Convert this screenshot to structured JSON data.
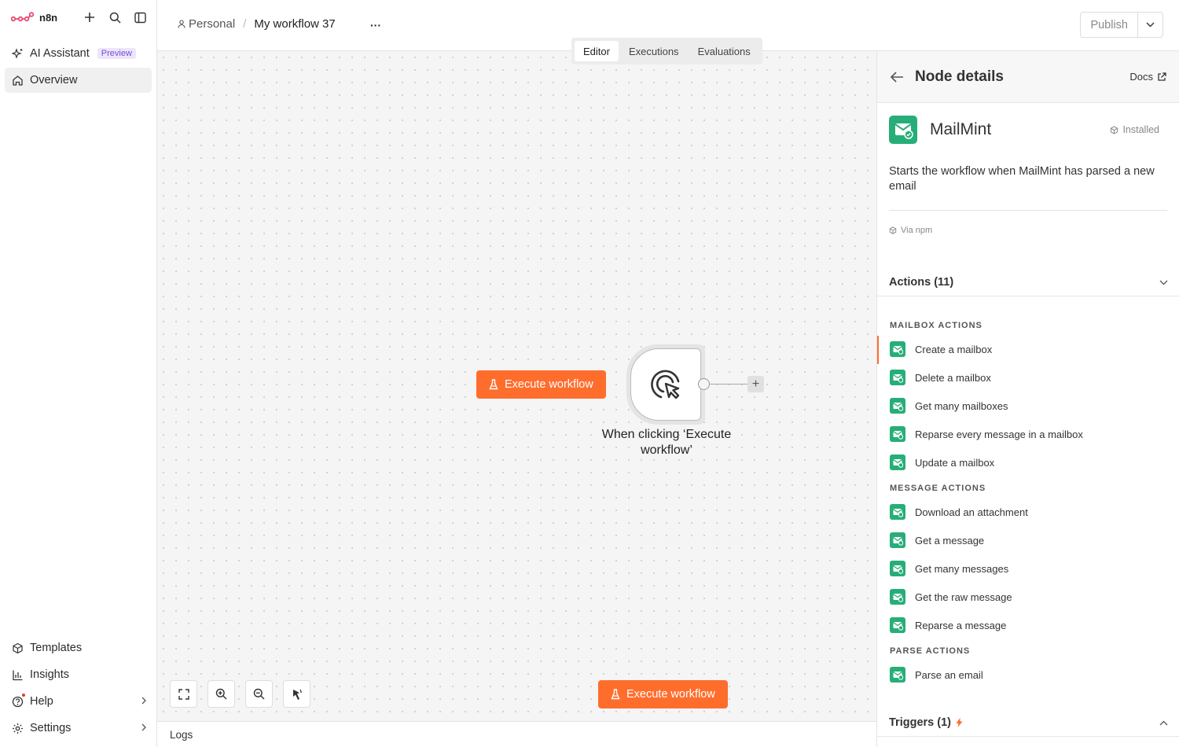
{
  "app": {
    "logo_text": "n8n"
  },
  "sidebar": {
    "top_items": [
      {
        "label": "AI Assistant",
        "badge": "Preview",
        "icon": "sparkle-icon"
      },
      {
        "label": "Overview",
        "icon": "home-icon"
      }
    ],
    "bottom_items": [
      {
        "label": "Templates",
        "icon": "box-icon"
      },
      {
        "label": "Insights",
        "icon": "bar-chart-icon"
      },
      {
        "label": "Help",
        "icon": "help-icon"
      },
      {
        "label": "Settings",
        "icon": "gear-icon"
      }
    ]
  },
  "header": {
    "breadcrumb_project": "Personal",
    "breadcrumb_separator": "/",
    "workflow_name": "My workflow 37",
    "more_label": "···",
    "publish_label": "Publish",
    "tabs": [
      "Editor",
      "Executions",
      "Evaluations"
    ],
    "active_tab": "Editor"
  },
  "canvas": {
    "execute_label": "Execute workflow",
    "node_label": "When clicking ‘Execute workflow’",
    "plus_label": "+",
    "bottom_execute_label": "Execute workflow",
    "controls": [
      "fit-view-icon",
      "zoom-in-icon",
      "zoom-out-icon",
      "tidy-up-icon"
    ]
  },
  "logs": {
    "label": "Logs"
  },
  "panel": {
    "title": "Node details",
    "docs_label": "Docs",
    "node_name": "MailMint",
    "installed_label": "Installed",
    "description": "Starts the workflow when MailMint has parsed a new email",
    "via_label": "Via npm",
    "actions_header": "Actions (11)",
    "groups": [
      {
        "title": "MAILBOX ACTIONS",
        "items": [
          "Create a mailbox",
          "Delete a mailbox",
          "Get many mailboxes",
          "Reparse every message in a mailbox",
          "Update a mailbox"
        ]
      },
      {
        "title": "MESSAGE ACTIONS",
        "items": [
          "Download an attachment",
          "Get a message",
          "Get many messages",
          "Get the raw message",
          "Reparse a message"
        ]
      },
      {
        "title": "PARSE ACTIONS",
        "items": [
          "Parse an email"
        ]
      }
    ],
    "triggers_header": "Triggers (1)"
  },
  "colors": {
    "accent": "#ff6d2d",
    "node_green": "#27ae78",
    "preview_badge": "#7a4ad8"
  }
}
